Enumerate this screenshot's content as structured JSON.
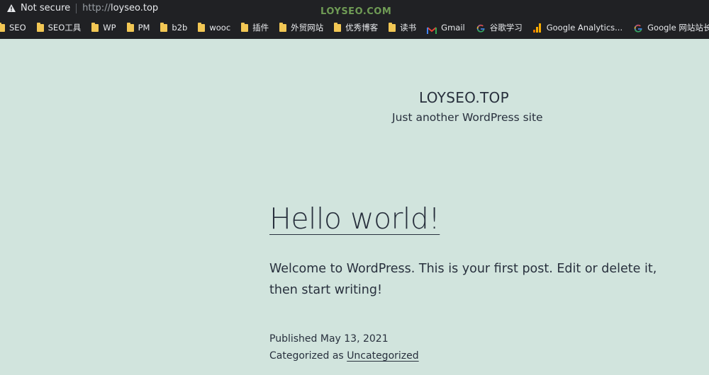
{
  "browser": {
    "security_label": "Not secure",
    "url_scheme": "http://",
    "url_host": "loyseo.top",
    "watermark": "LOYSEO.COM"
  },
  "bookmarks": [
    {
      "label": "SEO",
      "icon": "folder-icon"
    },
    {
      "label": "SEO工具",
      "icon": "folder-icon"
    },
    {
      "label": "WP",
      "icon": "folder-icon"
    },
    {
      "label": "PM",
      "icon": "folder-icon"
    },
    {
      "label": "b2b",
      "icon": "folder-icon"
    },
    {
      "label": "wooc",
      "icon": "folder-icon"
    },
    {
      "label": "插件",
      "icon": "folder-icon"
    },
    {
      "label": "外贸网站",
      "icon": "folder-icon"
    },
    {
      "label": "优秀博客",
      "icon": "folder-icon"
    },
    {
      "label": "读书",
      "icon": "folder-icon"
    },
    {
      "label": "Gmail",
      "icon": "gmail-icon"
    },
    {
      "label": "谷歌学习",
      "icon": "google-icon"
    },
    {
      "label": "Google Analytics...",
      "icon": "analytics-icon"
    },
    {
      "label": "Google 网站站长",
      "icon": "google-icon"
    }
  ],
  "site": {
    "title": "LOYSEO.TOP",
    "description": "Just another WordPress site"
  },
  "post": {
    "title": "Hello world!",
    "body": "Welcome to WordPress. This is your first post. Edit or delete it, then start writing!",
    "published_prefix": "Published",
    "published_date": "May 13, 2021",
    "categorized_prefix": "Categorized as",
    "category": "Uncategorized"
  },
  "colors": {
    "page_background": "#d1e4dd",
    "text": "#28303d",
    "browser_chrome": "#202124",
    "folder": "#f2c754"
  }
}
